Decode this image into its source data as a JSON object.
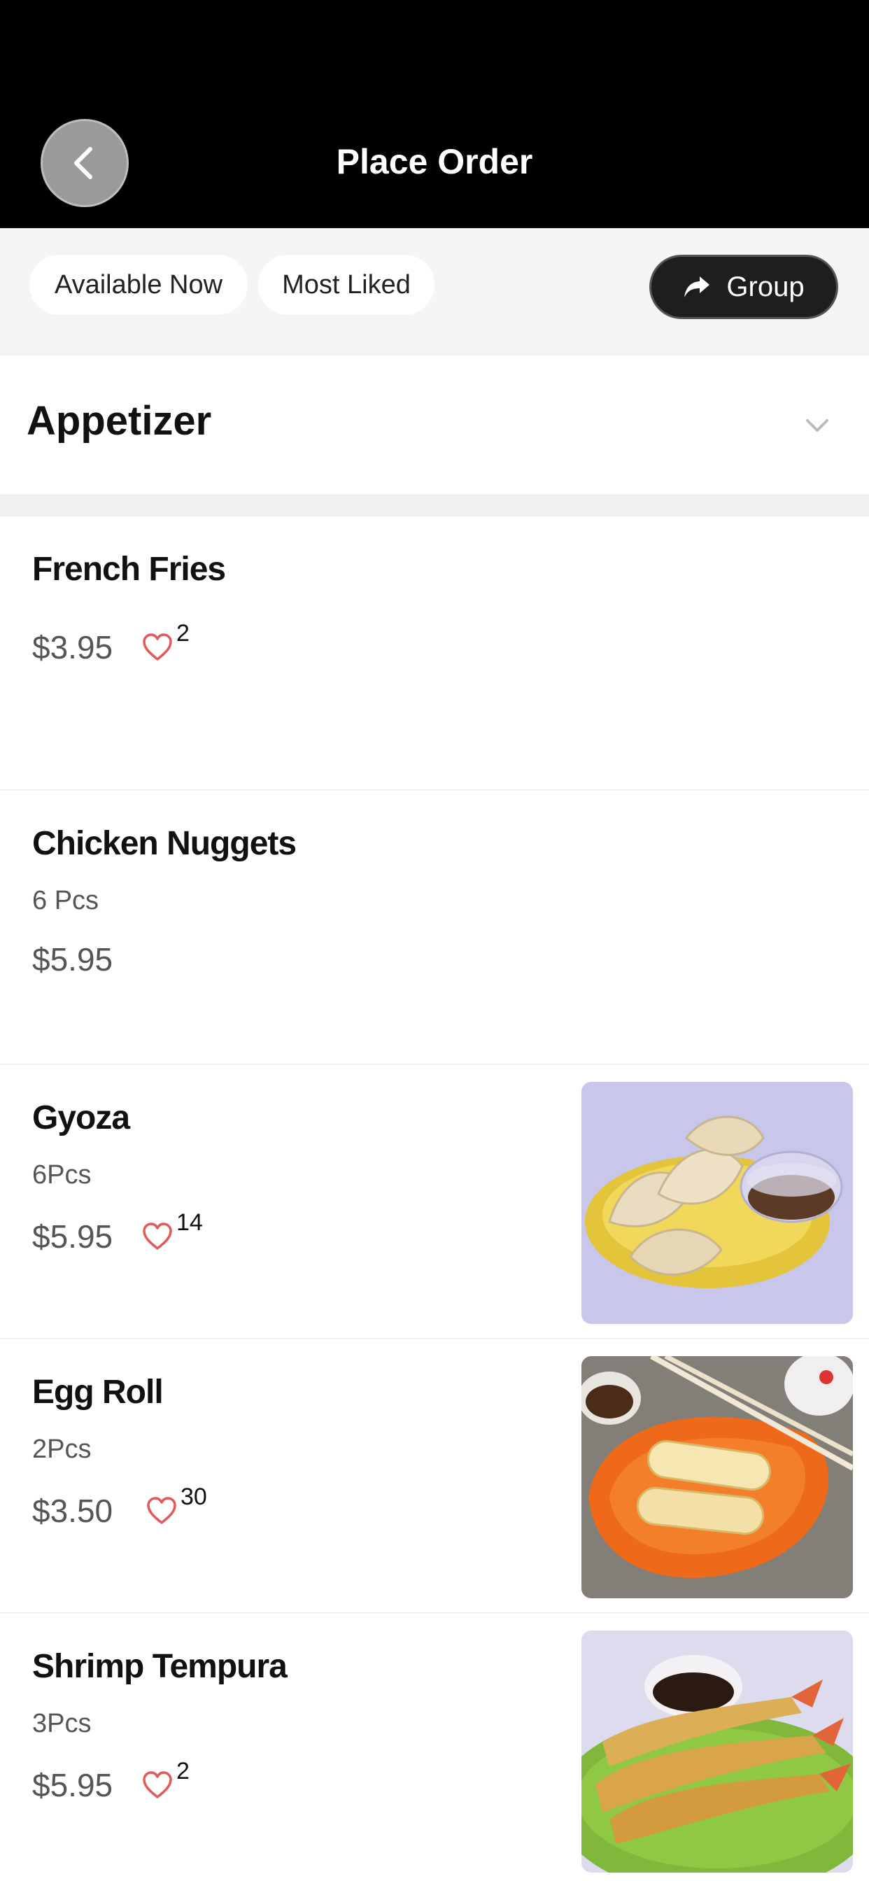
{
  "header": {
    "title": "Place Order"
  },
  "filters": {
    "available_now": "Available Now",
    "most_liked": "Most Liked",
    "group": "Group"
  },
  "category": {
    "title": "Appetizer"
  },
  "items": [
    {
      "name": "French Fries",
      "desc": "",
      "price": "$3.95",
      "likes": "2"
    },
    {
      "name": "Chicken Nuggets",
      "desc": "6 Pcs",
      "price": "$5.95",
      "likes": ""
    },
    {
      "name": "Gyoza",
      "desc": "6Pcs",
      "price": "$5.95",
      "likes": "14"
    },
    {
      "name": "Egg Roll",
      "desc": "2Pcs",
      "price": "$3.50",
      "likes": "30"
    },
    {
      "name": "Shrimp Tempura",
      "desc": "3Pcs",
      "price": "$5.95",
      "likes": "2"
    }
  ],
  "colors": {
    "header_bg": "#000000",
    "heart": "#e05a5a",
    "group_btn": "#1e1e1e"
  }
}
